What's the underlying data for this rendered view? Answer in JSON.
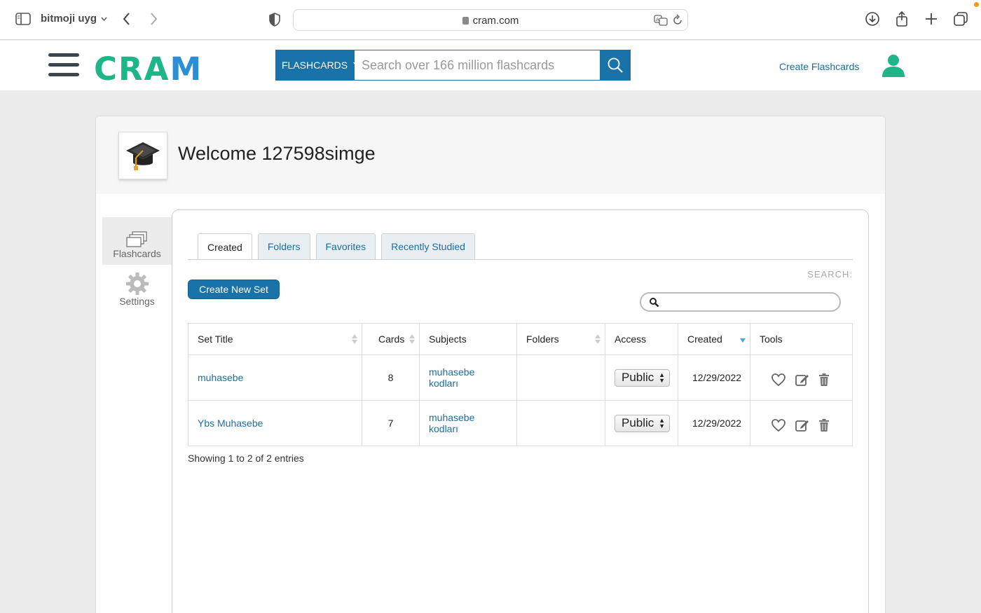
{
  "browser": {
    "tab_group": "bitmoji uyg",
    "url": "cram.com"
  },
  "header": {
    "logo": "CRAM",
    "search_type": "FLASHCARDS",
    "search_placeholder": "Search over 166 million flashcards",
    "create_link": "Create Flashcards"
  },
  "profile": {
    "welcome": "Welcome 127598simge"
  },
  "sidebar": {
    "items": [
      {
        "label": "Flashcards",
        "icon": "flashcards-icon"
      },
      {
        "label": "Settings",
        "icon": "gear-icon"
      }
    ]
  },
  "tabs": [
    {
      "label": "Created"
    },
    {
      "label": "Folders"
    },
    {
      "label": "Favorites"
    },
    {
      "label": "Recently Studied"
    }
  ],
  "toolbar": {
    "create_set_label": "Create New Set",
    "search_label": "SEARCH:"
  },
  "table": {
    "headers": [
      "Set Title",
      "Cards",
      "Subjects",
      "Folders",
      "Access",
      "Created",
      "Tools"
    ],
    "rows": [
      {
        "title": "muhasebe",
        "cards": "8",
        "subject_line1": "muhasebe",
        "subject_line2": "kodları",
        "folders": "",
        "access": "Public",
        "created": "12/29/2022"
      },
      {
        "title": "Ybs Muhasebe",
        "cards": "7",
        "subject_line1": "muhasebe",
        "subject_line2": "kodları",
        "folders": "",
        "access": "Public",
        "created": "12/29/2022"
      }
    ],
    "footer": "Showing 1 to 2 of 2 entries"
  },
  "colors": {
    "brand_green": "#1fb58a",
    "brand_blue": "#1a73a8",
    "link_blue": "#1a6fa3"
  }
}
